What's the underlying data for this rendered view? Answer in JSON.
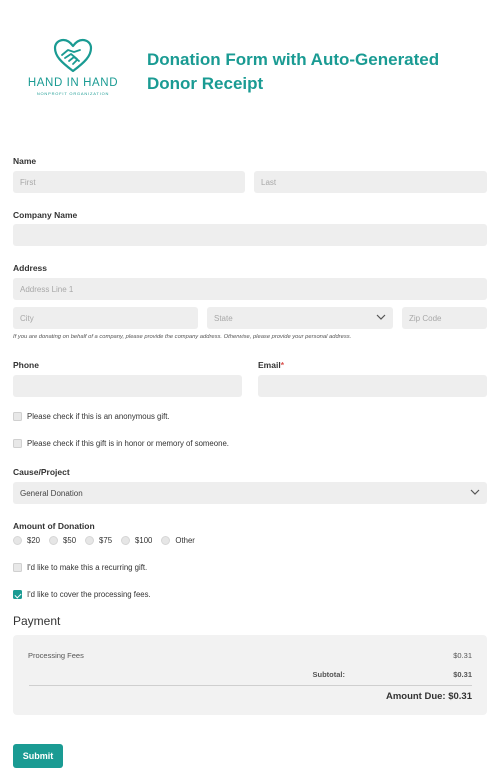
{
  "org": {
    "name": "HAND IN HAND",
    "subtitle": "NONPROFIT ORGANIZATION"
  },
  "form_title": "Donation Form with Auto-Generated Donor Receipt",
  "name_field": {
    "label": "Name",
    "first_placeholder": "First",
    "last_placeholder": "Last"
  },
  "company": {
    "label": "Company Name",
    "value": ""
  },
  "address": {
    "label": "Address",
    "line1_placeholder": "Address Line 1",
    "city_placeholder": "City",
    "state_placeholder": "State",
    "zip_placeholder": "Zip Code",
    "note": "If you are donating on behalf of a company, please provide the company address. Otherwise, please provide your personal address."
  },
  "phone": {
    "label": "Phone",
    "value": ""
  },
  "email": {
    "label": "Email",
    "required_mark": "*",
    "value": ""
  },
  "checks": {
    "anonymous": {
      "label": "Please check if this is an anonymous gift.",
      "checked": false
    },
    "honor": {
      "label": "Please check if this gift is in honor or memory of someone.",
      "checked": false
    }
  },
  "cause": {
    "label": "Cause/Project",
    "selected": "General Donation"
  },
  "amount": {
    "label": "Amount of Donation",
    "options": [
      "$20",
      "$50",
      "$75",
      "$100",
      "Other"
    ]
  },
  "recurring": {
    "label": "I'd like to make this a recurring gift.",
    "checked": false
  },
  "fees": {
    "label": "I'd like to cover the processing fees.",
    "checked": true
  },
  "payment": {
    "title": "Payment",
    "fee_label": "Processing Fees",
    "fee_value": "$0.31",
    "subtotal_label": "Subtotal:",
    "subtotal_value": "$0.31",
    "amount_due": "Amount Due: $0.31"
  },
  "submit_label": "Submit",
  "colors": {
    "accent": "#1a9b93",
    "field_bg": "#eeeeee",
    "required": "#d9534f"
  },
  "icons": {
    "logo": "handshake-heart-icon",
    "select": "chevron-down-icon",
    "checked": "checkmark-icon"
  }
}
